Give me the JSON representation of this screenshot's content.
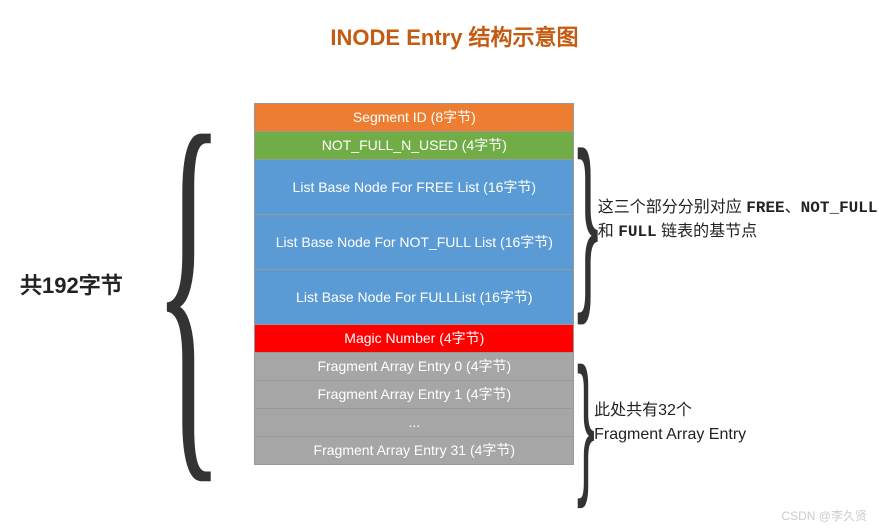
{
  "title": "INODE Entry 结构示意图",
  "left_label": "共192字节",
  "rows": {
    "segment_id": "Segment ID (8字节)",
    "not_full_n_used": "NOT_FULL_N_USED (4字节)",
    "free_list": "List Base Node For FREE List (16字节)",
    "not_full_list": "List Base Node For NOT_FULL List (16字节)",
    "full_list": "List Base Node For FULLList (16字节)",
    "magic_number": "Magic Number (4字节)",
    "frag0": "Fragment Array Entry 0 (4字节)",
    "frag1": "Fragment Array Entry 1 (4字节)",
    "dots": "...",
    "frag31": "Fragment Array Entry 31 (4字节)"
  },
  "note1": {
    "pre": "这三个部分分别对应 ",
    "b1": "FREE",
    "mid1": "、",
    "b2": "NOT_FULL",
    "mid2": " 和 ",
    "b3": "FULL",
    "post": " 链表的基节点"
  },
  "note2": {
    "line1": "此处共有32个",
    "line2": "Fragment Array Entry"
  },
  "watermark": "CSDN @李久贤"
}
